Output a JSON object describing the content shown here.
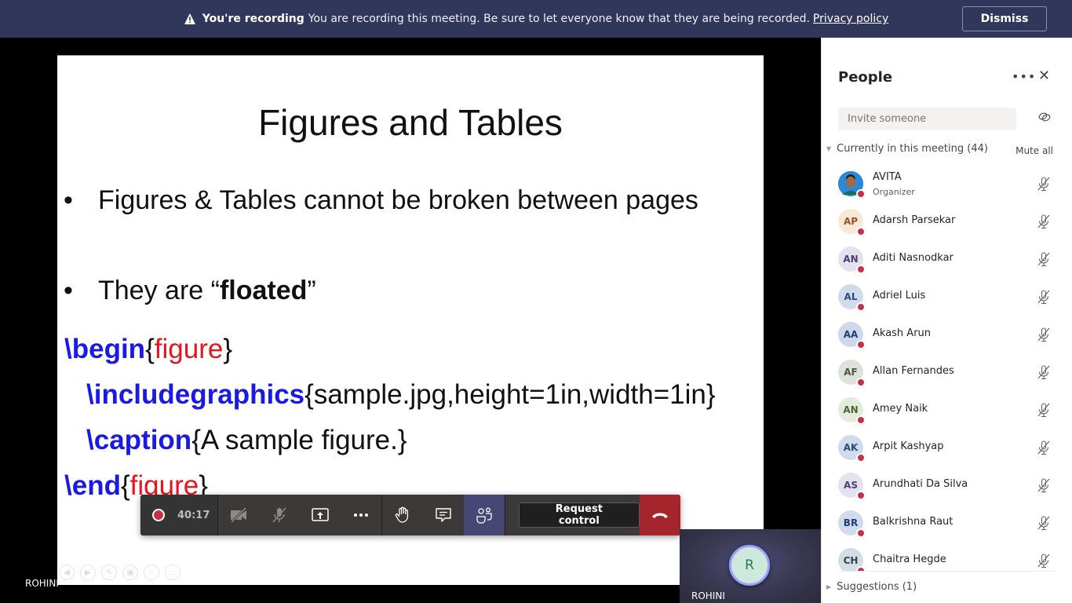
{
  "banner": {
    "title": "You're recording",
    "message": "You are recording this meeting. Be sure to let everyone know that they are being recorded.",
    "link": "Privacy policy",
    "dismiss_label": "Dismiss",
    "icon": "warning-icon"
  },
  "slide": {
    "title": "Figures and Tables",
    "bullets": [
      {
        "bullet": "•",
        "text": "Figures & Tables cannot be broken between pages"
      },
      {
        "bullet": "•",
        "prefix": "They are “",
        "bold": "floated",
        "suffix": "”"
      }
    ],
    "code": [
      {
        "cmd": "\\begin",
        "open": "{",
        "arg": "figure",
        "close": "}"
      },
      {
        "cmd": "\\includegraphics",
        "text": "{sample.jpg,height=1in,width=1in}"
      },
      {
        "cmd": "\\caption",
        "text": "{A sample figure.}"
      },
      {
        "cmd": "\\end",
        "open": "{",
        "arg": "figure",
        "close": "}"
      }
    ],
    "colors": {
      "command": "#1a1ae6",
      "argument": "#e8141e"
    }
  },
  "presenter_name": "ROHINI",
  "controls": {
    "recording_icon": "record-icon",
    "timer": "40:17",
    "request_control_label": "Request control",
    "hangup_color": "#a4262c"
  },
  "self_tile": {
    "initial": "R",
    "name": "ROHINI"
  },
  "people": {
    "title": "People",
    "invite_placeholder": "Invite someone",
    "section_label": "Currently in this meeting (44)",
    "mute_all_label": "Mute all",
    "suggestions_label": "Suggestions (1)",
    "participants": [
      {
        "name": "AVITA",
        "role": "Organizer",
        "initials": "",
        "bg": "#2b88d8",
        "fg": "#ffffff"
      },
      {
        "name": "Adarsh Parsekar",
        "initials": "AP",
        "bg": "#fbe7d6",
        "fg": "#8e562e"
      },
      {
        "name": "Aditi Nasnodkar",
        "initials": "AN",
        "bg": "#e6e1f0",
        "fg": "#4a3f6b"
      },
      {
        "name": "Adriel Luis",
        "initials": "AL",
        "bg": "#d0dcee",
        "fg": "#2b4a7e"
      },
      {
        "name": "Akash Arun",
        "initials": "AA",
        "bg": "#cdd8eb",
        "fg": "#1f3f75"
      },
      {
        "name": "Allan Fernandes",
        "initials": "AF",
        "bg": "#dde2da",
        "fg": "#4a5a3f"
      },
      {
        "name": "Amey Naik",
        "initials": "AN",
        "bg": "#e5ecdc",
        "fg": "#486433"
      },
      {
        "name": "Arpit Kashyap",
        "initials": "AK",
        "bg": "#d0dcee",
        "fg": "#2b4a7e"
      },
      {
        "name": "Arundhati Da Silva",
        "initials": "AS",
        "bg": "#e6e1f0",
        "fg": "#4a3f6b"
      },
      {
        "name": "Balkrishna Raut",
        "initials": "BR",
        "bg": "#d0dcee",
        "fg": "#1f3f75"
      },
      {
        "name": "Chaitra Hegde",
        "initials": "CH",
        "bg": "#d5dde3",
        "fg": "#2e4556"
      }
    ]
  }
}
